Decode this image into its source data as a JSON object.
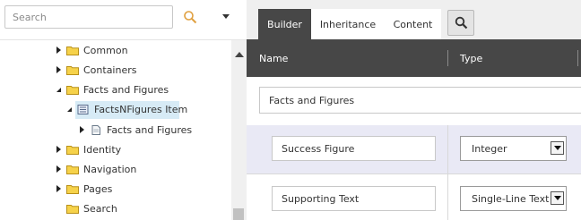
{
  "search": {
    "placeholder": "Search",
    "value": ""
  },
  "tree": {
    "items": [
      {
        "label": "Common",
        "expanded": false
      },
      {
        "label": "Containers",
        "expanded": false
      },
      {
        "label": "Facts and Figures",
        "expanded": true
      },
      {
        "label": "FactsNFigures Item",
        "expanded": true,
        "selected": true,
        "icon": "template-icon"
      },
      {
        "label": "Facts and Figures",
        "expanded": false,
        "icon": "document-icon"
      },
      {
        "label": "Identity",
        "expanded": false
      },
      {
        "label": "Navigation",
        "expanded": false
      },
      {
        "label": "Pages",
        "expanded": false
      },
      {
        "label": "Search",
        "expanded": false
      }
    ]
  },
  "tabs": [
    {
      "label": "Builder",
      "active": true
    },
    {
      "label": "Inheritance",
      "active": false
    },
    {
      "label": "Content",
      "active": false
    }
  ],
  "grid": {
    "columns": {
      "name": "Name",
      "type": "Type"
    },
    "section": {
      "value": "Facts and Figures"
    },
    "fields": [
      {
        "name": "Success Figure",
        "type": "Integer"
      },
      {
        "name": "Supporting Text",
        "type": "Single-Line Text"
      }
    ]
  },
  "colors": {
    "tab_active": "#474747",
    "header_bg": "#474747",
    "selected_bg": "#d7ebf6",
    "folder": "#f1c232"
  }
}
